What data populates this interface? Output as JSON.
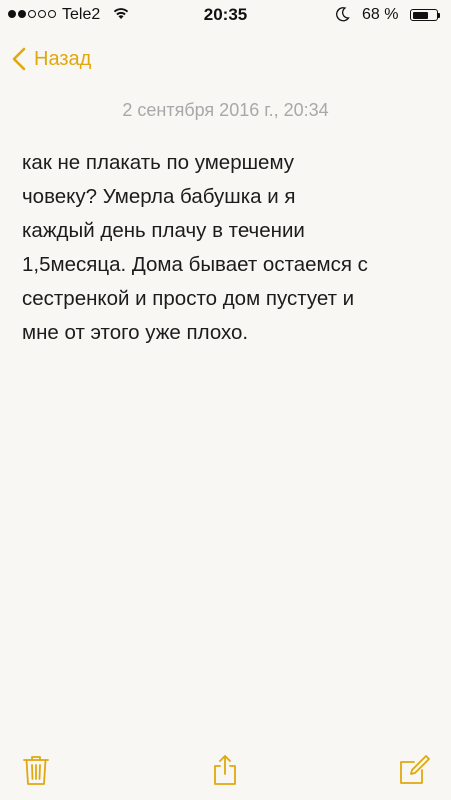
{
  "status_bar": {
    "carrier": "Tele2",
    "time": "20:35",
    "battery_percent": "68 %",
    "battery_level": 0.68,
    "signal_bars_filled": 2,
    "signal_bars_total": 5
  },
  "nav": {
    "back_label": "Назад"
  },
  "note": {
    "date": "2 сентября 2016 г., 20:34",
    "body": "как не плакать по умершему\nчовеку? Умерла бабушка и я\nкаждый день плачу в течении\n1,5месяца. Дома бывает остаемся с\nсестренкой и просто дом пустует и\nмне от этого уже плохо."
  },
  "toolbar": {
    "icons": [
      "trash-icon",
      "share-icon",
      "compose-icon"
    ]
  },
  "colors": {
    "accent": "#e0a80c",
    "date_text": "#a8a8a8",
    "background": "#f8f7f4"
  }
}
